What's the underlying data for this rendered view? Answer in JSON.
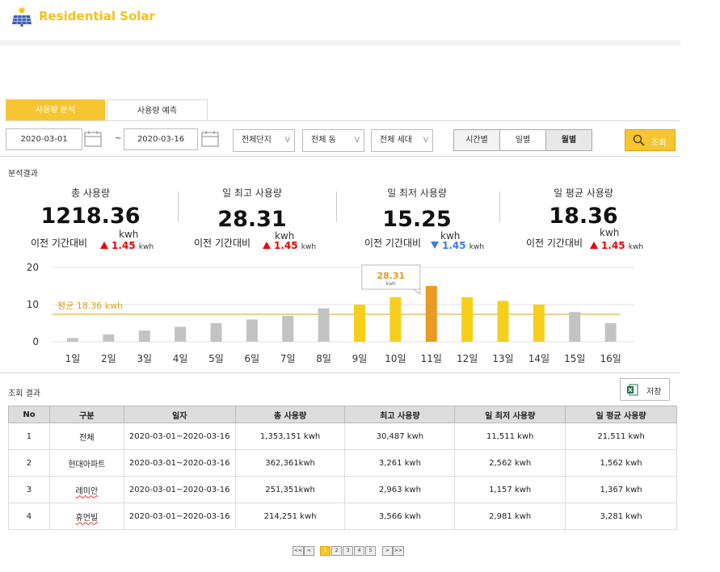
{
  "app": {
    "brand": "Residential Solar",
    "logo_icon": "solar-panel-icon"
  },
  "tabs": [
    {
      "label": "사용량 분석",
      "active": true
    },
    {
      "label": "사용량 예측",
      "active": false
    }
  ],
  "filters": {
    "date_from": "2020-03-01",
    "tilde": "~",
    "date_to": "2020-03-16",
    "complex": "전체단지",
    "building": "전체 동",
    "household": "전체 세대",
    "select_chevron": "V",
    "granularity": [
      "시간별",
      "일별",
      "월별"
    ],
    "granularity_selected": "월별",
    "search_label": "조회"
  },
  "analysis": {
    "title": "분석결과",
    "compare_label": "이전 기간대비",
    "unit": "kwh",
    "kpis": [
      {
        "label": "총 사용량",
        "value": "1218.36",
        "delta": "1.45",
        "direction": "up"
      },
      {
        "label": "일 최고 사용량",
        "value": "28.31",
        "delta": "1.45",
        "direction": "up"
      },
      {
        "label": "일 최저 사용량",
        "value": "15.25",
        "delta": "1.45",
        "direction": "down"
      },
      {
        "label": "일 평균 사용량",
        "value": "18.36",
        "delta": "1.45",
        "direction": "up"
      }
    ]
  },
  "chart_data": {
    "type": "bar",
    "categories": [
      "1일",
      "2일",
      "3일",
      "4일",
      "5일",
      "6일",
      "7일",
      "8일",
      "9일",
      "10일",
      "11일",
      "12일",
      "13일",
      "14일",
      "15일",
      "16일"
    ],
    "values": [
      1,
      2,
      3,
      4,
      5,
      6,
      7,
      9,
      10,
      12,
      15,
      12,
      11,
      10,
      8,
      5
    ],
    "yticks": [
      "20",
      "10",
      "0"
    ],
    "ylim": [
      0,
      20
    ],
    "average": 18.36,
    "average_label": "평균 18.36 kwh",
    "tooltip": {
      "value": "28.31",
      "unit": "kwh",
      "category": "11일"
    },
    "colors": {
      "normal": "#c3c3c3",
      "highlight": "#f5cf1c",
      "max": "#e89a22",
      "average": "#d9a21a"
    },
    "highlight_range": [
      "9일",
      "14일"
    ],
    "grid": true
  },
  "results": {
    "title": "조회 결과",
    "save_label": "저장",
    "headers": [
      "No",
      "구분",
      "일자",
      "총 사용량",
      "최고 사용량",
      "일 최저 사용량",
      "일 평균 사용량"
    ],
    "rows": [
      [
        "1",
        "전체",
        "2020-03-01~2020-03-16",
        "1,353,151 kwh",
        "30,487 kwh",
        "11,511 kwh",
        "21,511 kwh"
      ],
      [
        "2",
        "현대아파트",
        "2020-03-01~2020-03-16",
        "362,361kwh",
        "3,261 kwh",
        "2,562 kwh",
        "1,562 kwh"
      ],
      [
        "3",
        "레미안",
        "2020-03-01~2020-03-16",
        "251,351kwh",
        "2,963 kwh",
        "1,157 kwh",
        "1,367 kwh"
      ],
      [
        "4",
        "휴먼빌",
        "2020-03-01~2020-03-16",
        "214,251 kwh",
        "3,566 kwh",
        "2,981 kwh",
        "3,281 kwh"
      ]
    ]
  },
  "pagination": {
    "first": "<<",
    "prev": "<",
    "pages": [
      "1",
      "2",
      "3",
      "4",
      "5"
    ],
    "current": "1",
    "next": ">",
    "last": ">>"
  }
}
